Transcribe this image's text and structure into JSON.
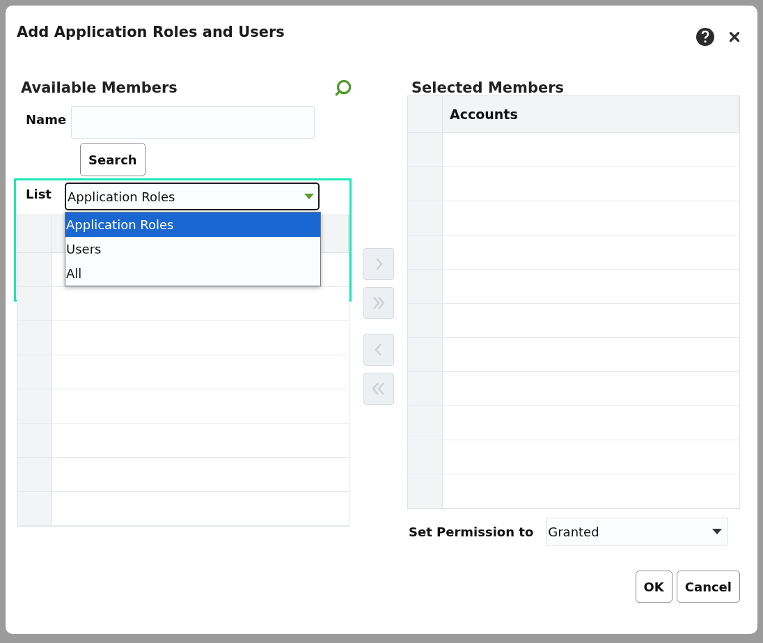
{
  "dialog": {
    "title": "Add Application Roles and Users",
    "available": {
      "heading": "Available Members",
      "name_label": "Name",
      "search_button": "Search",
      "list_label": "List",
      "list_value": "Application Roles",
      "list_open": true,
      "options": [
        {
          "label": "Application Roles",
          "selected": true
        },
        {
          "label": "Users",
          "selected": false
        },
        {
          "label": "All",
          "selected": false
        }
      ]
    },
    "transfer_buttons": [
      {
        "kind": "move",
        "disabled": true
      },
      {
        "kind": "move_all",
        "disabled": true
      },
      {
        "kind": "remove",
        "disabled": true
      },
      {
        "kind": "remove_all",
        "disabled": true
      }
    ],
    "selected": {
      "heading": "Selected Members",
      "columns": [
        "Accounts"
      ]
    },
    "permission": {
      "label": "Set Permission to",
      "value": "Granted"
    },
    "buttons": [
      "OK",
      "Cancel"
    ]
  }
}
